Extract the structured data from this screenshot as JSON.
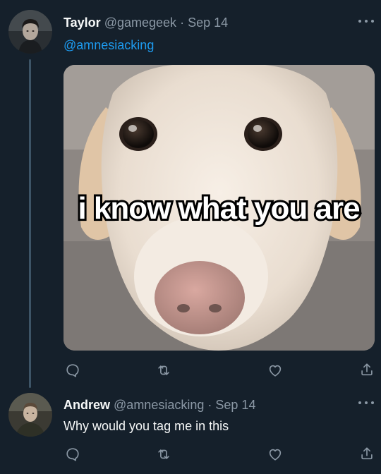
{
  "tweets": [
    {
      "author_name": "Taylor",
      "author_handle": "@gamegeek",
      "separator": "·",
      "date": "Sep 14",
      "mention": "@amnesiacking",
      "media_caption": "i know what you are"
    },
    {
      "author_name": "Andrew",
      "author_handle": "@amnesiacking",
      "separator": "·",
      "date": "Sep 14",
      "text": "Why would you tag me in this"
    }
  ],
  "icons": {
    "reply": "comment-bubble-icon",
    "retweet": "retweet-icon",
    "like": "heart-icon",
    "share": "share-icon",
    "more": "more-dots-icon"
  },
  "colors": {
    "background": "#15202b",
    "link": "#1d9bf0",
    "muted": "#8b98a5",
    "thread_line": "#3d5466"
  }
}
